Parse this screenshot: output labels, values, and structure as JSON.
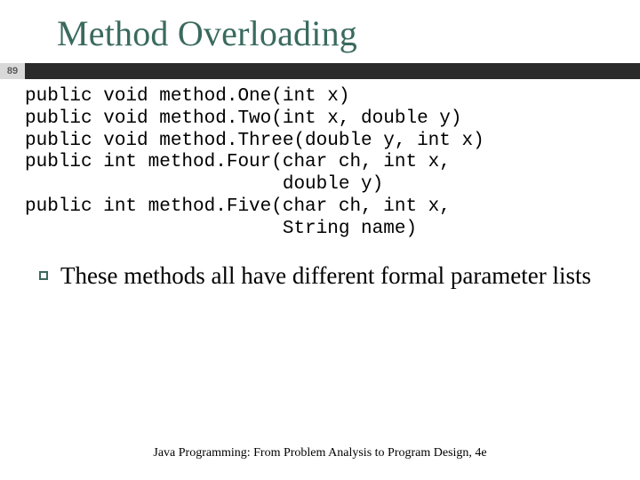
{
  "slide": {
    "title": "Method Overloading",
    "page_number": "89",
    "code": "public void method.One(int x)\npublic void method.Two(int x, double y)\npublic void method.Three(double y, int x)\npublic int method.Four(char ch, int x,\n                       double y)\npublic int method.Five(char ch, int x,\n                       String name)",
    "bullet": "These methods all have different formal parameter lists",
    "footer": "Java Programming: From Problem Analysis to Program Design, 4e"
  }
}
